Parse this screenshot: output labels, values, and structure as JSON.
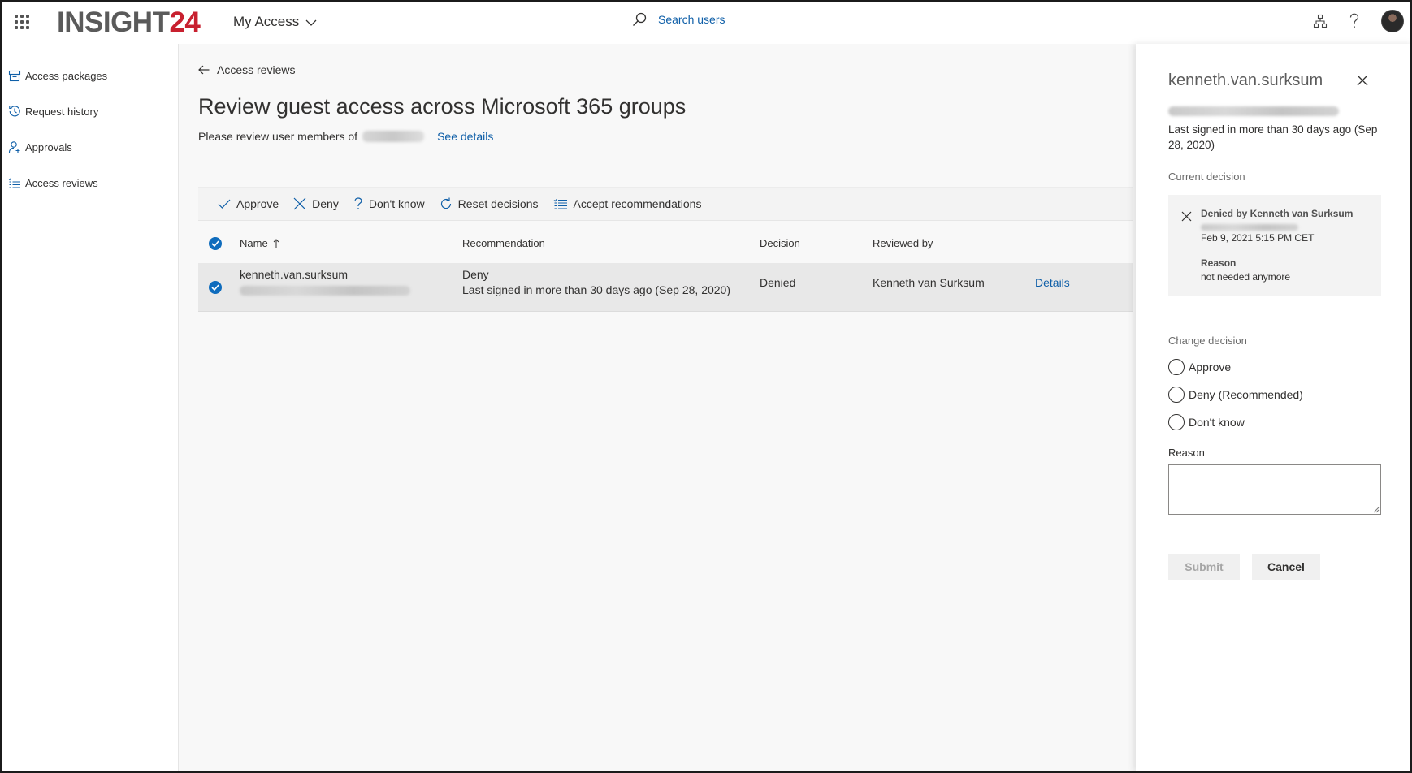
{
  "header": {
    "logo_main": "INSIGHT",
    "logo_accent": "24",
    "app_title": "My Access",
    "search_placeholder": "Search users"
  },
  "sidebar": {
    "items": [
      {
        "label": "Access packages",
        "icon": "package-icon"
      },
      {
        "label": "Request history",
        "icon": "history-icon"
      },
      {
        "label": "Approvals",
        "icon": "person-add-icon"
      },
      {
        "label": "Access reviews",
        "icon": "checklist-icon"
      }
    ]
  },
  "main": {
    "back_label": "Access reviews",
    "title": "Review guest access across Microsoft 365 groups",
    "subtitle": "Please review user members of",
    "see_details": "See details",
    "toolbar": {
      "approve": "Approve",
      "deny": "Deny",
      "dont_know": "Don't know",
      "reset": "Reset decisions",
      "accept": "Accept recommendations"
    },
    "columns": {
      "name": "Name",
      "recommendation": "Recommendation",
      "decision": "Decision",
      "reviewed_by": "Reviewed by"
    },
    "rows": [
      {
        "name": "kenneth.van.surksum",
        "recommendation": "Deny",
        "recommendation_detail": "Last signed in more than 30 days ago (Sep 28, 2020)",
        "decision": "Denied",
        "reviewed_by": "Kenneth van Surksum",
        "details_link": "Details"
      }
    ]
  },
  "panel": {
    "title": "kenneth.van.surksum",
    "last_signed": "Last signed in more than 30 days ago (Sep 28, 2020)",
    "current_decision_label": "Current decision",
    "current_decision": {
      "by": "Denied by Kenneth van Surksum",
      "date": "Feb 9, 2021 5:15 PM CET",
      "reason_label": "Reason",
      "reason": "not needed anymore"
    },
    "change_decision_label": "Change decision",
    "options": [
      "Approve",
      "Deny (Recommended)",
      "Don't know"
    ],
    "reason_label": "Reason",
    "reason_value": "",
    "submit": "Submit",
    "cancel": "Cancel"
  },
  "colors": {
    "accent": "#0f6cbd",
    "link": "#0f5fa8",
    "logo_accent": "#c8202f"
  }
}
